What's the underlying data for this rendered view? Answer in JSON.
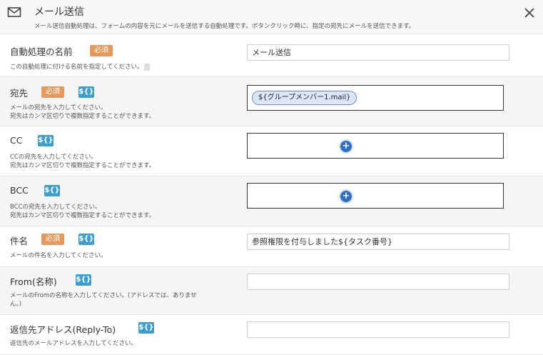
{
  "dialog": {
    "title": "メール送信",
    "description": "メール送信自動処理は、フォームの内容を元にメールを送信する自動処理です。ボタンクリック時に、指定の宛先にメールを送信できます。",
    "icon": "mail-icon",
    "close_icon": "close-icon"
  },
  "badges": {
    "required": "必須",
    "variable": "${}"
  },
  "fields": {
    "name": {
      "label": "自動処理の名前",
      "help": "この自動処理に付ける名前を指定してください。",
      "value": "メール送信"
    },
    "to": {
      "label": "宛先",
      "help1": "メールの宛先を入力してください。",
      "help2": "宛先はカンマ区切りで複数指定することができます。",
      "chip": "${グループメンバー1.mail}"
    },
    "cc": {
      "label": "CC",
      "help1": "CCの宛先を入力してください。",
      "help2": "宛先はカンマ区切りで複数指定することができます。"
    },
    "bcc": {
      "label": "BCC",
      "help1": "BCCの宛先を入力してください。",
      "help2": "宛先はカンマ区切りで複数指定することができます。"
    },
    "subject": {
      "label": "件名",
      "help": "メールの件名を入力してください。",
      "value": "参照権限を付与しました${タスク番号}"
    },
    "from_name": {
      "label": "From(名称)",
      "help1": "メールのFromの名称を入力してください。(アドレスでは、ありませ",
      "help2": "ん。)",
      "value": ""
    },
    "reply_to": {
      "label": "返信先アドレス(Reply-To)",
      "help": "返信先のメールアドレスを入力してください。",
      "value": ""
    }
  }
}
